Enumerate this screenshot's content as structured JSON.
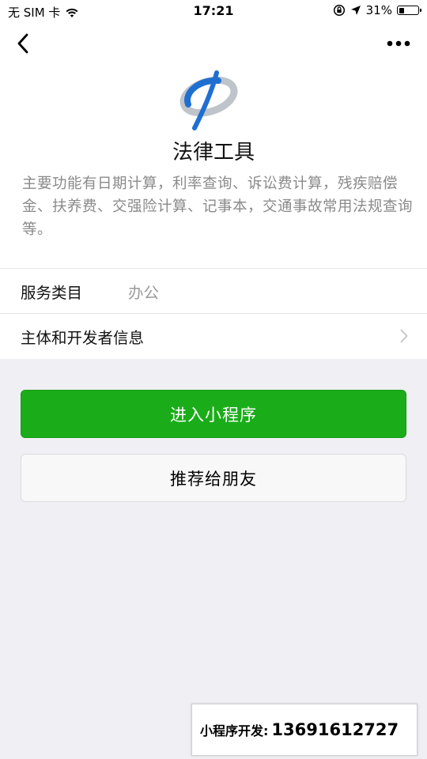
{
  "status_bar": {
    "carrier": "无 SIM 卡",
    "time": "17:21",
    "battery_percent": "31%",
    "battery_level": 0.31
  },
  "nav": {
    "back_icon": "chevron-left-icon",
    "more_icon": "more-dots-icon"
  },
  "app": {
    "logo_icon": "phi-logo-icon",
    "name": "法律工具",
    "description": "主要功能有日期计算，利率查询、诉讼费计算，残疾赔偿金、扶养费、交强险计算、记事本，交通事故常用法规查询等。"
  },
  "info": {
    "category_label": "服务类目",
    "category_value": "办公",
    "developer_label": "主体和开发者信息"
  },
  "buttons": {
    "enter_label": "进入小程序",
    "share_label": "推荐给朋友"
  },
  "promo": {
    "label": "小程序开发:",
    "phone": "13691612727"
  },
  "colors": {
    "primary_green": "#1aad19",
    "background": "#efeff4",
    "logo_blue": "#1f6fd1"
  }
}
